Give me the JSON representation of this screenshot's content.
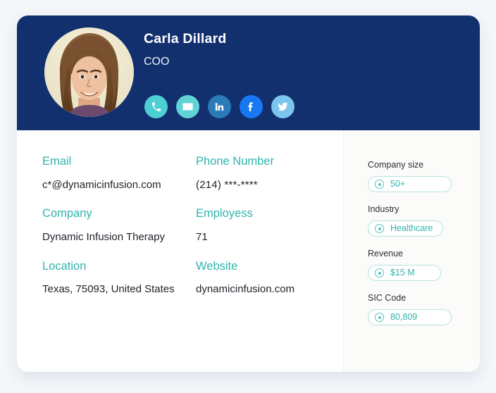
{
  "profile": {
    "name": "Carla Dillard",
    "title": "COO",
    "avatar_name": "profile-photo",
    "social": [
      {
        "id": "phone",
        "label": "Phone",
        "icon": "phone-icon",
        "color": "#4ecfd1"
      },
      {
        "id": "email",
        "label": "Email",
        "icon": "envelope-icon",
        "color": "#5fd3d6"
      },
      {
        "id": "linkedin",
        "label": "LinkedIn",
        "icon": "linkedin-icon",
        "color": "#2a7bb8"
      },
      {
        "id": "facebook",
        "label": "Facebook",
        "icon": "facebook-icon",
        "color": "#1877f2"
      },
      {
        "id": "twitter",
        "label": "Twitter",
        "icon": "twitter-icon",
        "color": "#7cc5ec"
      }
    ]
  },
  "fields": [
    {
      "label": "Email",
      "value": "c*@dynamicinfusion.com"
    },
    {
      "label": "Phone Number",
      "value": "(214) ***-****"
    },
    {
      "label": "Company",
      "value": "Dynamic Infusion Therapy"
    },
    {
      "label": "Employess",
      "value": "71"
    },
    {
      "label": "Location",
      "value": "Texas, 75093, United States"
    },
    {
      "label": "Website",
      "value": "dynamicinfusion.com"
    }
  ],
  "sidebar": [
    {
      "label": "Company size",
      "value": "50+"
    },
    {
      "label": "Industry",
      "value": "Healthcare"
    },
    {
      "label": "Revenue",
      "value": "$15 M"
    },
    {
      "label": "SIC Code",
      "value": "80,809"
    }
  ],
  "colors": {
    "header_bg": "#12306e",
    "accent_teal": "#2fb5ac",
    "pill_border": "#b7e2dd",
    "page_bg": "#f4f6fa"
  }
}
